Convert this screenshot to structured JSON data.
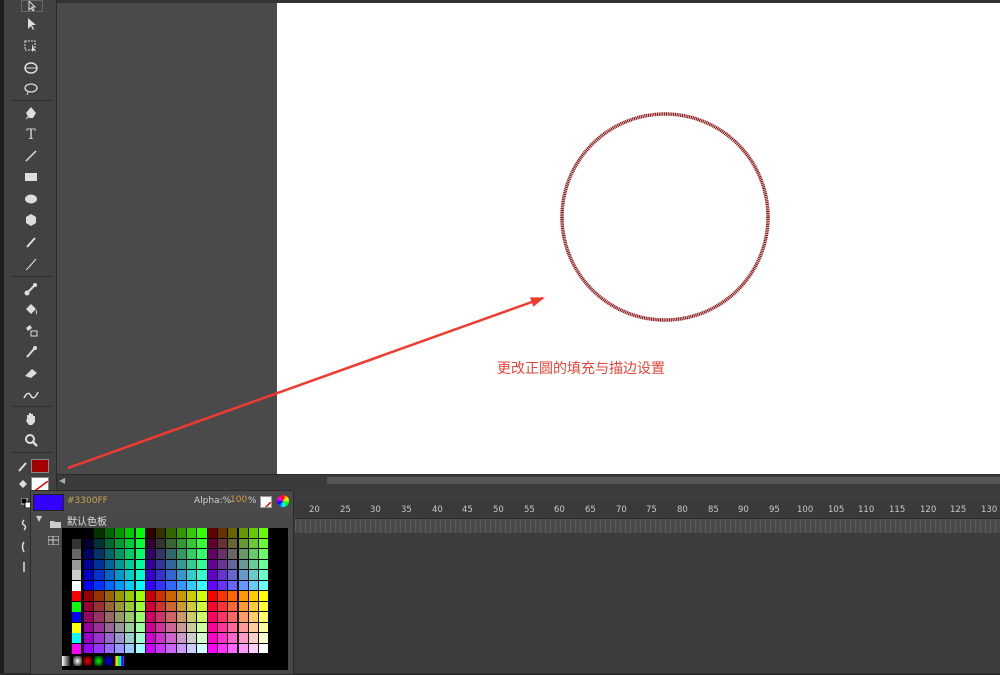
{
  "toolbar": {
    "tools": [
      "selection",
      "subselection",
      "free-transform",
      "3d-rotation",
      "lasso",
      "pen",
      "text",
      "line",
      "rectangle",
      "oval",
      "polystar",
      "pencil",
      "brush",
      "bone",
      "paint-bucket",
      "ink-bottle",
      "eyedropper",
      "eraser",
      "width",
      "hand",
      "zoom"
    ],
    "text_tool_label": "T"
  },
  "colors": {
    "stroke": "#A50000",
    "fill": "none",
    "current_swatch": "#3300FF",
    "annotation": "#E8433A",
    "circle_stroke": "#8B1A1A"
  },
  "stage": {
    "annotation_text": "更改正圆的填充与描边设置"
  },
  "swatches": {
    "hex_value": "#3300FF",
    "alpha_label": "Alpha:%",
    "alpha_value": "100",
    "alpha_suffix": "%",
    "folder_name": "默认色板"
  },
  "timeline": {
    "frame_numbers": [
      "20",
      "25",
      "30",
      "35",
      "40",
      "45",
      "50",
      "55",
      "60",
      "65",
      "70",
      "75",
      "80",
      "85",
      "90",
      "95",
      "100",
      "105",
      "110",
      "115",
      "120",
      "125",
      "130"
    ]
  }
}
